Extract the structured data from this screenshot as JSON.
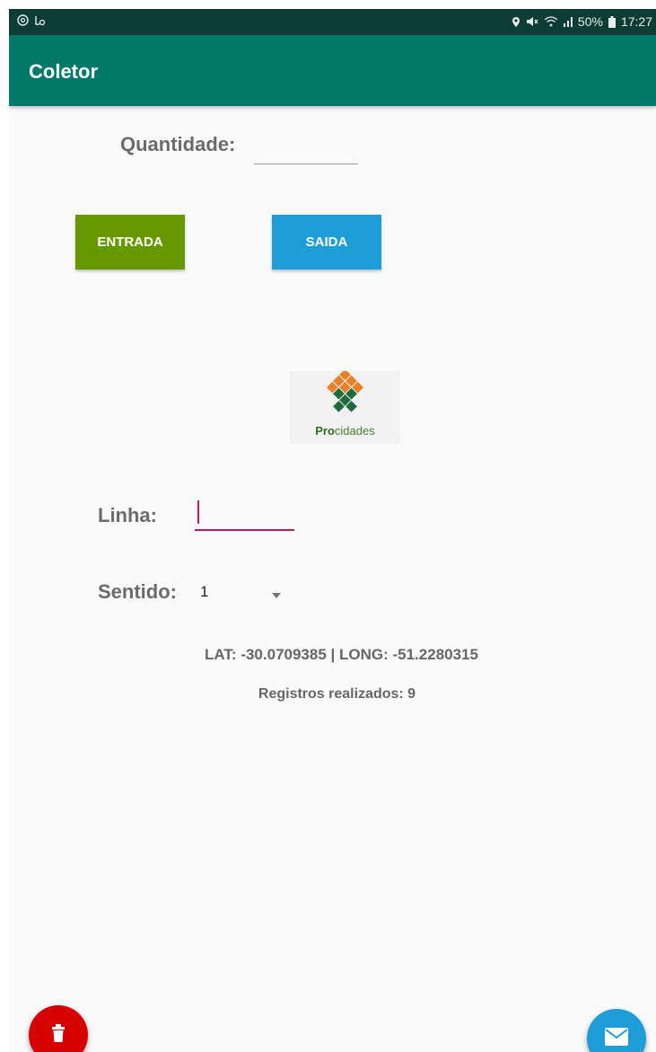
{
  "status_bar": {
    "left_icons": [
      "at-sign-icon",
      "screenshot-icon"
    ],
    "right_icons": [
      "location-pin-icon",
      "mute-icon",
      "wifi-icon",
      "signal-icon"
    ],
    "battery": "50%",
    "time": "17:27"
  },
  "app_bar": {
    "title": "Coletor"
  },
  "form": {
    "quantity_label": "Quantidade:",
    "quantity_value": "",
    "entrada_label": "ENTRADA",
    "saida_label": "SAIDA",
    "linha_label": "Linha:",
    "linha_value": "",
    "sentido_label": "Sentido:",
    "sentido_value": "1"
  },
  "logo": {
    "brand_bold": "Pro",
    "brand_rest": "cidades"
  },
  "info": {
    "coordinates": "LAT: -30.0709385 | LONG: -51.2280315",
    "registros": "Registros realizados: 9"
  },
  "fabs": {
    "delete_icon": "trash-icon",
    "mail_icon": "mail-icon"
  },
  "colors": {
    "app_bar": "#00796b",
    "status_bar": "#0b3d35",
    "entrada": "#669900",
    "saida": "#1e9ed6",
    "accent": "#c2185b",
    "fab_delete": "#d50000",
    "fab_mail": "#1e9ed6"
  }
}
